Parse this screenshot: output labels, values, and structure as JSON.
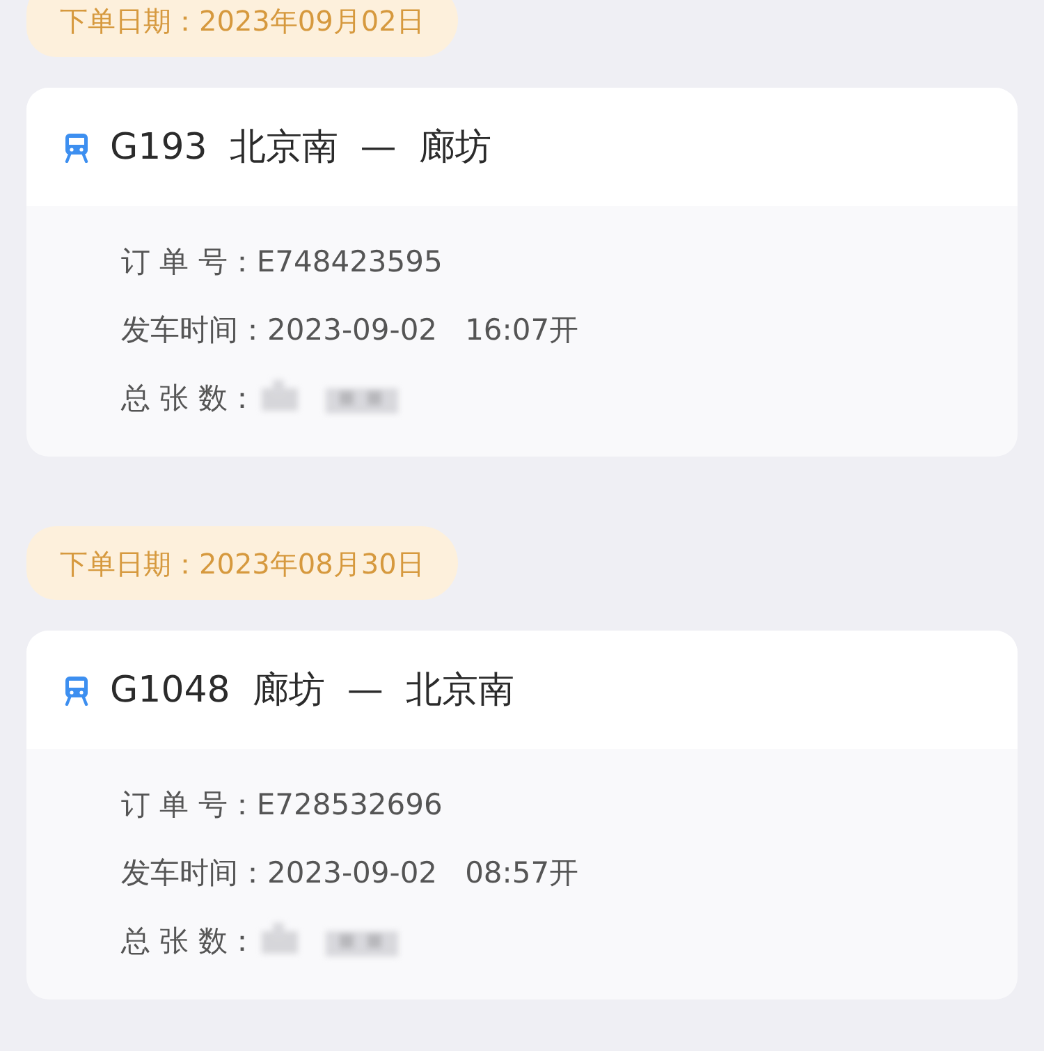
{
  "orders": [
    {
      "order_date": "下单日期：2023年09月02日",
      "train": "G193",
      "from": "北京南",
      "separator": "—",
      "to": "廊坊",
      "fields": [
        {
          "label": "订 单 号：",
          "value": "E748423595"
        },
        {
          "label": "发车时间：",
          "value": "2023-09-02   16:07开"
        },
        {
          "label": "总 张 数：",
          "blurred": true
        }
      ]
    },
    {
      "order_date": "下单日期：2023年08月30日",
      "train": "G1048",
      "from": "廊坊",
      "separator": "—",
      "to": "北京南",
      "fields": [
        {
          "label": "订 单 号：",
          "value": "E728532696"
        },
        {
          "label": "发车时间：",
          "value": "2023-09-02   08:57开"
        },
        {
          "label": "总 张 数：",
          "blurred": true
        }
      ]
    }
  ]
}
